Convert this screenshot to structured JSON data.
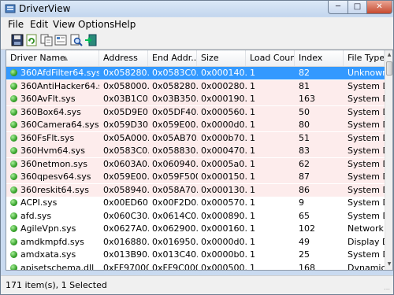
{
  "window": {
    "title": "DriverView"
  },
  "menu": [
    "File",
    "Edit",
    "View",
    "Options",
    "Help"
  ],
  "toolbar": [
    {
      "name": "save-icon"
    },
    {
      "name": "refresh-icon"
    },
    {
      "name": "copy-icon"
    },
    {
      "name": "properties-icon"
    },
    {
      "name": "find-icon"
    },
    {
      "name": "exit-icon"
    }
  ],
  "columns": [
    "Driver Name",
    "Address",
    "End Addr...",
    "Size",
    "Load Count",
    "Index",
    "File Type"
  ],
  "rows": [
    {
      "name": "360AfdFilter64.sys",
      "address": "0x058280...",
      "end": "0x0583C0...",
      "size": "0x000140...",
      "load": "1",
      "index": "82",
      "type": "Unknown"
    },
    {
      "name": "360AntiHacker64.sys",
      "address": "0x058000...",
      "end": "0x058280...",
      "size": "0x000280...",
      "load": "1",
      "index": "81",
      "type": "System D"
    },
    {
      "name": "360AvFlt.sys",
      "address": "0x03B1C0...",
      "end": "0x03B350...",
      "size": "0x000190...",
      "load": "1",
      "index": "163",
      "type": "System D"
    },
    {
      "name": "360Box64.sys",
      "address": "0x05D9E0...",
      "end": "0x05DF40...",
      "size": "0x000560...",
      "load": "1",
      "index": "50",
      "type": "System D"
    },
    {
      "name": "360Camera64.sys",
      "address": "0x059D30...",
      "end": "0x059E00...",
      "size": "0x0000d0...",
      "load": "1",
      "index": "80",
      "type": "System D"
    },
    {
      "name": "360FsFlt.sys",
      "address": "0x05A000...",
      "end": "0x05AB70...",
      "size": "0x000b70...",
      "load": "1",
      "index": "51",
      "type": "System D"
    },
    {
      "name": "360Hvm64.sys",
      "address": "0x0583C0...",
      "end": "0x058830...",
      "size": "0x000470...",
      "load": "1",
      "index": "83",
      "type": "System D"
    },
    {
      "name": "360netmon.sys",
      "address": "0x0603A0...",
      "end": "0x060940...",
      "size": "0x0005a0...",
      "load": "1",
      "index": "62",
      "type": "System D"
    },
    {
      "name": "360qpesv64.sys",
      "address": "0x059E00...",
      "end": "0x059F5000",
      "size": "0x000150...",
      "load": "1",
      "index": "87",
      "type": "System D"
    },
    {
      "name": "360reskit64.sys",
      "address": "0x058940...",
      "end": "0x058A70...",
      "size": "0x000130...",
      "load": "1",
      "index": "86",
      "type": "System D"
    },
    {
      "name": "ACPI.sys",
      "address": "0x00ED60...",
      "end": "0x00F2D0...",
      "size": "0x000570...",
      "load": "1",
      "index": "9",
      "type": "System D"
    },
    {
      "name": "afd.sys",
      "address": "0x060C30...",
      "end": "0x0614C0...",
      "size": "0x000890...",
      "load": "1",
      "index": "65",
      "type": "System D"
    },
    {
      "name": "AgileVpn.sys",
      "address": "0x0627A0...",
      "end": "0x062900...",
      "size": "0x000160...",
      "load": "1",
      "index": "102",
      "type": "Network"
    },
    {
      "name": "amdkmpfd.sys",
      "address": "0x016880...",
      "end": "0x016950...",
      "size": "0x0000d0...",
      "load": "1",
      "index": "49",
      "type": "Display D"
    },
    {
      "name": "amdxata.sys",
      "address": "0x013B90...",
      "end": "0x013C40...",
      "size": "0x0000b0...",
      "load": "1",
      "index": "25",
      "type": "System D"
    },
    {
      "name": "apisetschema.dll",
      "address": "0xFF970000",
      "end": "0xFF9C0000",
      "size": "0x000500...",
      "load": "1",
      "index": "168",
      "type": "Dynamic"
    }
  ],
  "status": {
    "text": "171 item(s), 1 Selected"
  },
  "colors": {
    "selection": "#3399ff",
    "alt_row": "#fdecec",
    "driver_dot": "#2e9a22"
  }
}
